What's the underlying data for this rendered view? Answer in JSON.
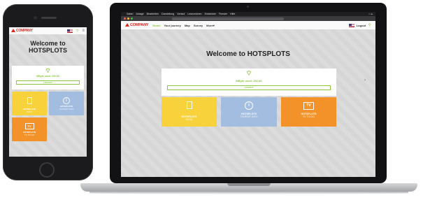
{
  "brand": {
    "logo_text": "COMPANY",
    "accent_color": "#8cc63f",
    "logo_color": "#e2231a"
  },
  "mac_menubar": {
    "items": [
      "Safari",
      "Ablage",
      "Bearbeiten",
      "Darstellung",
      "Verlauf",
      "Lesezeichen",
      "Entwickler",
      "Fenster",
      "Hilfe"
    ]
  },
  "nav": {
    "items": [
      "Home",
      "Your journey",
      "Map",
      "Survey",
      "More"
    ]
  },
  "header": {
    "logout_label": "Logout"
  },
  "hero": {
    "title": "Welcome to HOTSPLOTS",
    "title_phone": "Welcome to HOTSPLOTS"
  },
  "status_card": {
    "used_text": "MByte used: 252.83",
    "used_text_phone": "MByte used: 252.83",
    "logout_button": "LOGOUT"
  },
  "tiles": [
    {
      "title": "HOTSPLOTS",
      "subtitle": "PASS",
      "icon": "tablet-icon",
      "color": "#f8d23a"
    },
    {
      "title": "HOTSPLOTS",
      "subtitle": "TOURIST INFO",
      "icon": "info-icon",
      "color": "#a3bde0"
    },
    {
      "title": "HOTSPLOTS",
      "subtitle": "TV TO GO",
      "icon": "tv-icon",
      "color": "#f4922a"
    }
  ],
  "tile_icons": {
    "tv_label": "TV",
    "info_glyph": "i"
  }
}
